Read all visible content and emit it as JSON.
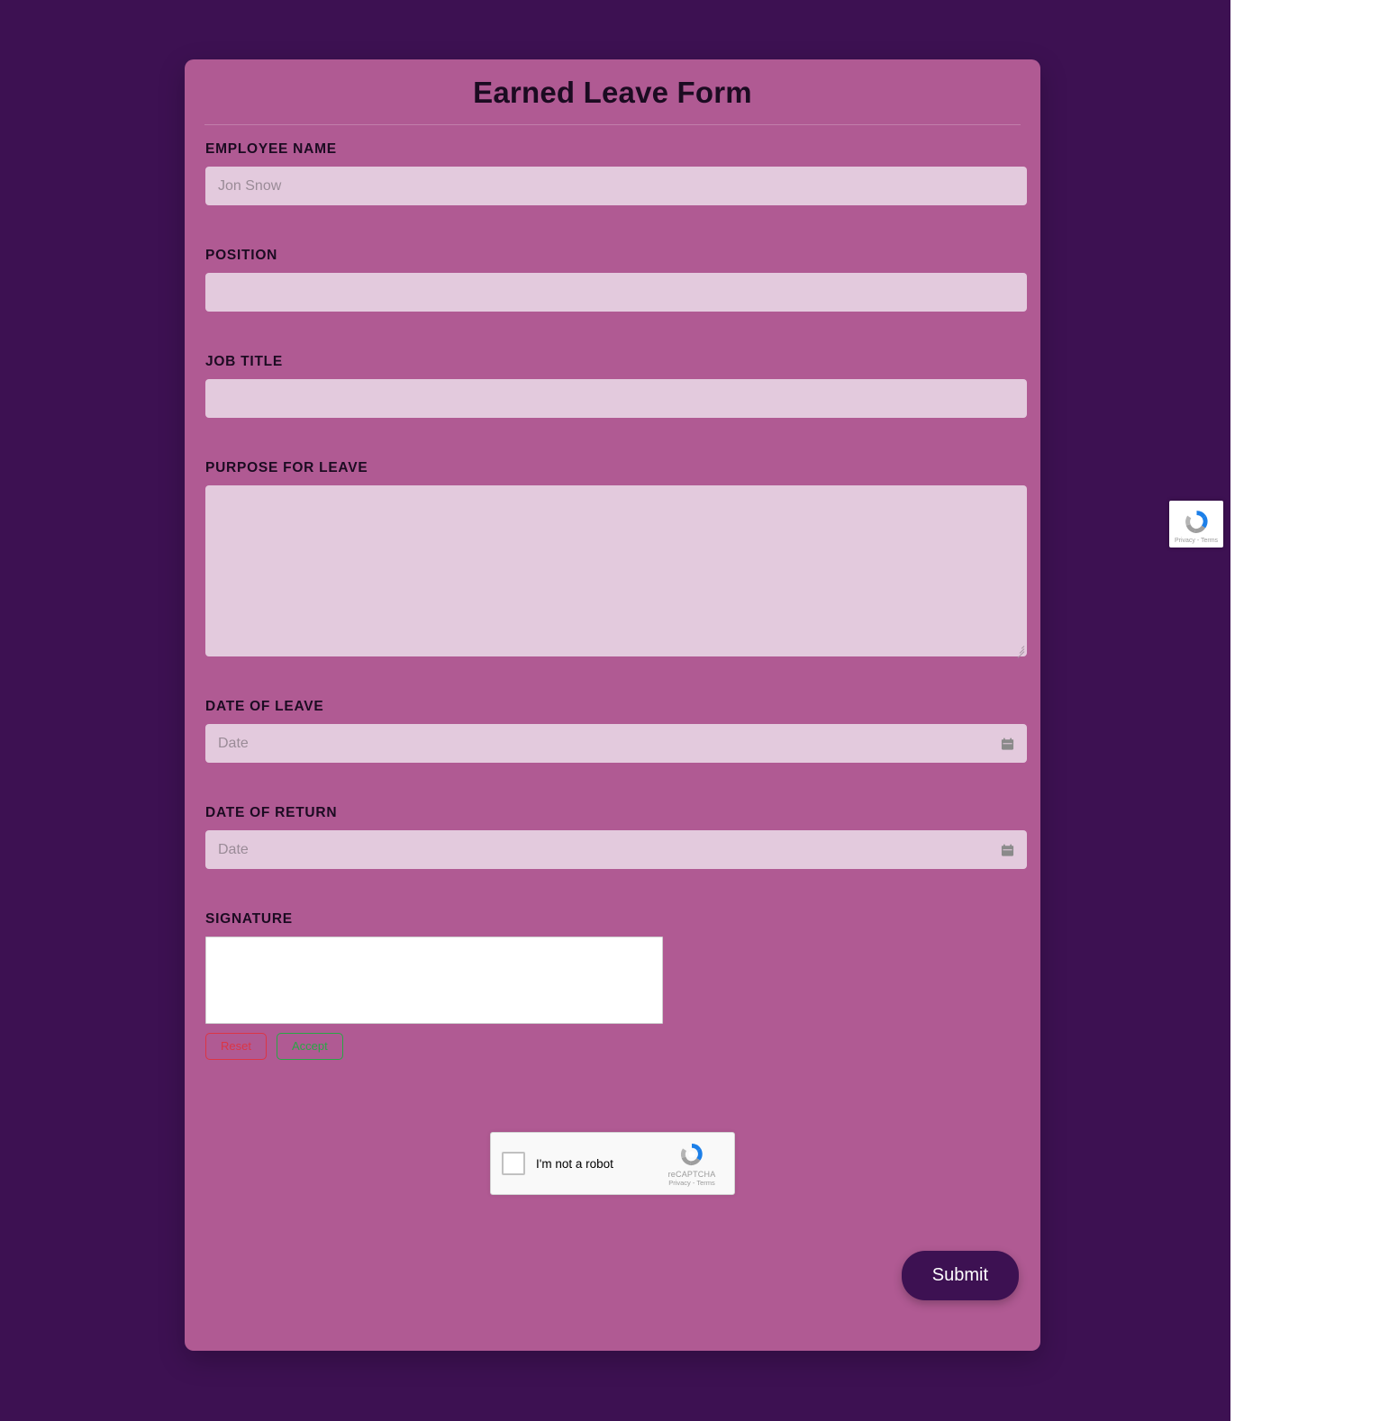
{
  "form": {
    "title": "Earned Leave Form",
    "fields": [
      {
        "label": "EMPLOYEE NAME",
        "placeholder": "Jon Snow",
        "value": "",
        "type": "text"
      },
      {
        "label": "POSITION",
        "placeholder": "",
        "value": "",
        "type": "text"
      },
      {
        "label": "JOB TITLE",
        "placeholder": "",
        "value": "",
        "type": "text"
      },
      {
        "label": "PURPOSE FOR LEAVE",
        "placeholder": "",
        "value": "",
        "type": "textarea"
      },
      {
        "label": "DATE OF LEAVE",
        "placeholder": "Date",
        "value": "",
        "type": "date"
      },
      {
        "label": "DATE OF RETURN",
        "placeholder": "Date",
        "value": "",
        "type": "date"
      },
      {
        "label": "SIGNATURE",
        "placeholder": "",
        "value": "",
        "type": "signature"
      }
    ],
    "signature": {
      "label": "SIGNATURE",
      "reset_label": "Reset",
      "accept_label": "Accept"
    },
    "submit_label": "Submit"
  },
  "recaptcha": {
    "checkbox_label": "I'm not a robot",
    "brand": "reCAPTCHA",
    "terms": "Privacy - Terms",
    "badge_terms": "Privacy - Terms"
  },
  "colors": {
    "page_background": "#3d1152",
    "card_background": "#b05a93",
    "input_background": "#e3cadd",
    "label_text": "#1b0b21",
    "submit_background": "#3d1152",
    "submit_text": "#ffffff",
    "reset_accent": "#dc3545",
    "accept_accent": "#28a745"
  }
}
